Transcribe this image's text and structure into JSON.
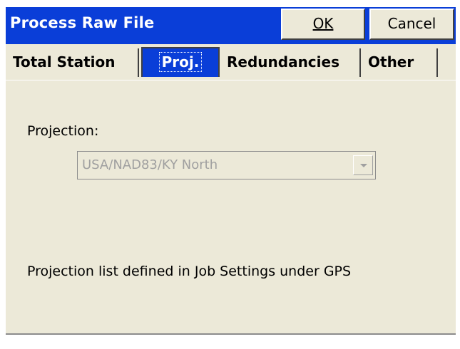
{
  "window": {
    "title": "Process Raw File",
    "ok_label": "OK",
    "cancel_label": "Cancel",
    "accent_color": "#0a3ed8",
    "background_color": "#ece9d8"
  },
  "tabs": [
    {
      "label": "Total Station",
      "selected": false
    },
    {
      "label": "Proj.",
      "selected": true
    },
    {
      "label": "Redundancies",
      "selected": false
    },
    {
      "label": "Other",
      "selected": false
    }
  ],
  "projection": {
    "label": "Projection:",
    "value": "USA/NAD83/KY North",
    "enabled": false,
    "dropdown_icon": "chevron-down-icon"
  },
  "note": "Projection list defined in Job Settings under GPS"
}
